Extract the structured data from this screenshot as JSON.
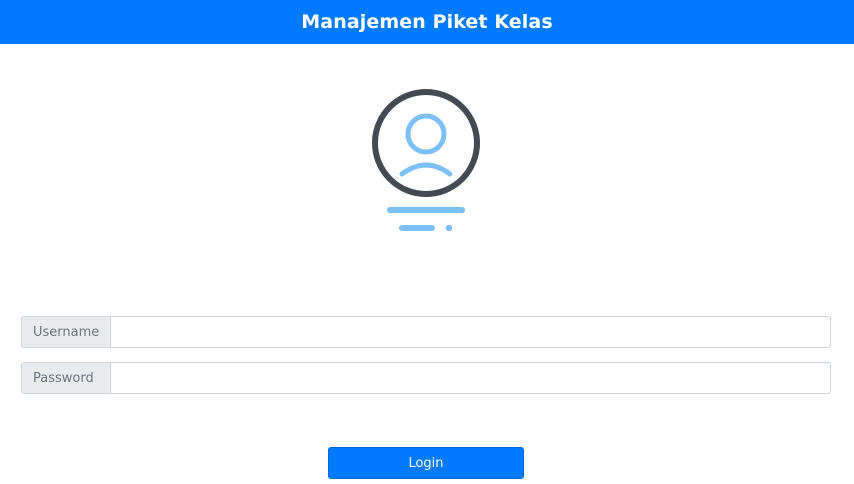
{
  "header": {
    "title": "Manajemen Piket Kelas"
  },
  "illustration": {
    "icon": "user-avatar-icon"
  },
  "form": {
    "username": {
      "label": "Username",
      "value": ""
    },
    "password": {
      "label": "Password",
      "value": ""
    },
    "login_label": "Login"
  },
  "colors": {
    "primary": "#007bff",
    "icon_outline": "#434a54",
    "icon_accent": "#7cc0f5",
    "addon_bg": "#e9ecef"
  }
}
